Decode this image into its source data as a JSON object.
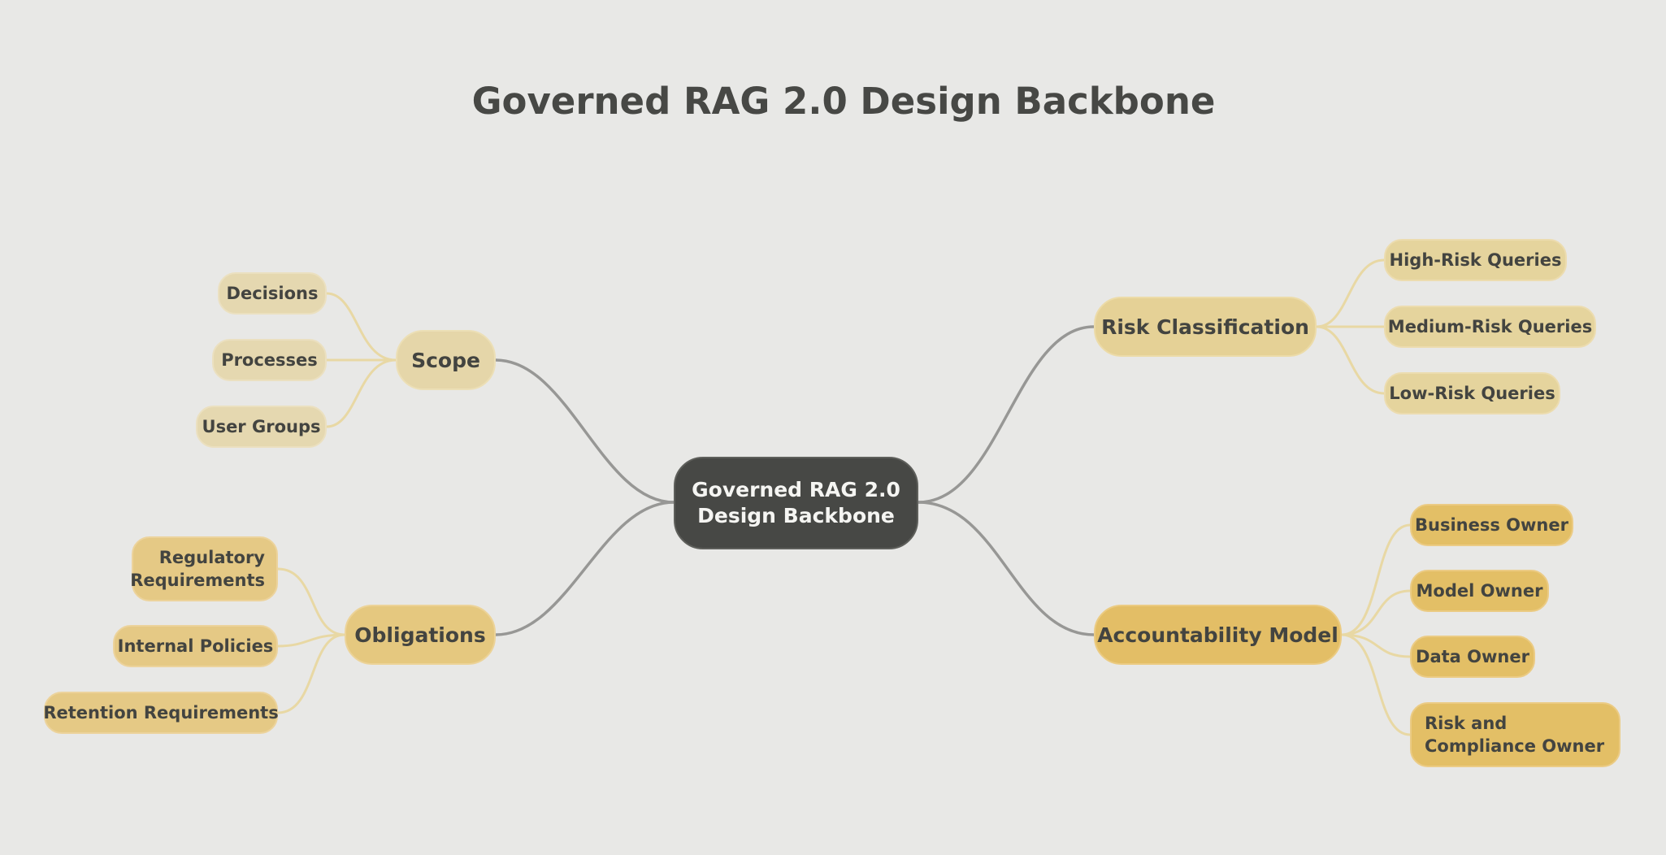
{
  "title": "Governed RAG 2.0 Design Backbone",
  "center": {
    "line1": "Governed RAG 2.0",
    "line2": "Design Backbone"
  },
  "colors": {
    "background": "#e8e8e6",
    "center": "#474845",
    "main_link": "#979795",
    "branch_link": "#e8d8a4",
    "scope": "#e5d6a9",
    "risk_classification": "#e5d196",
    "obligations": "#e5c87f",
    "accountability_model": "#e3be66"
  },
  "branches": {
    "scope": {
      "label": "Scope",
      "children": [
        "Decisions",
        "Processes",
        "User Groups"
      ]
    },
    "obligations": {
      "label": "Obligations",
      "children": [
        "Regulatory Requirements",
        "Internal Policies",
        "Retention Requirements"
      ]
    },
    "risk_classification": {
      "label": "Risk Classification",
      "children": [
        "High-Risk Queries",
        "Medium-Risk Queries",
        "Low-Risk Queries"
      ]
    },
    "accountability_model": {
      "label": "Accountability Model",
      "children": [
        "Business Owner",
        "Model Owner",
        "Data Owner",
        "Risk and Compliance Owner"
      ]
    }
  }
}
